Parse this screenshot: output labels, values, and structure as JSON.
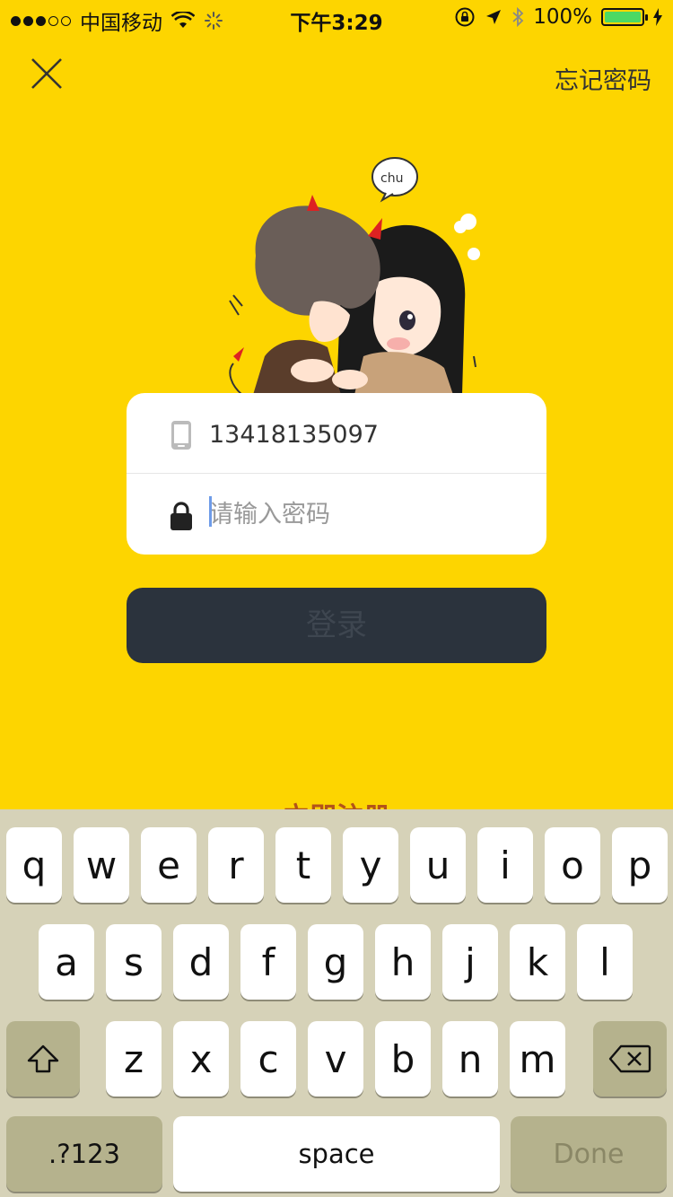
{
  "status_bar": {
    "carrier": "中国移动",
    "time": "下午3:29",
    "battery_percent": "100%",
    "signal_strength": 3,
    "battery_level": 1.0
  },
  "nav": {
    "close_icon": "close-icon",
    "forgot_password": "忘记密码"
  },
  "form": {
    "phone_value": "13418135097",
    "password_placeholder": "请输入密码",
    "phone_icon": "phone-icon",
    "lock_icon": "lock-icon"
  },
  "login_label": "登录",
  "register_label": "立即注册",
  "keyboard": {
    "row1": [
      "q",
      "w",
      "e",
      "r",
      "t",
      "y",
      "u",
      "i",
      "o",
      "p"
    ],
    "row2": [
      "a",
      "s",
      "d",
      "f",
      "g",
      "h",
      "j",
      "k",
      "l"
    ],
    "row3": [
      "z",
      "x",
      "c",
      "v",
      "b",
      "n",
      "m"
    ],
    "shift_icon": "shift-icon",
    "delete_icon": "delete-icon",
    "numbers_label": ".?123",
    "space_label": "space",
    "done_label": "Done"
  },
  "colors": {
    "background": "#FDD500",
    "login_button": "#2B333D",
    "register_text": "#B2531A",
    "keyboard_bg": "#D6D2B8"
  }
}
